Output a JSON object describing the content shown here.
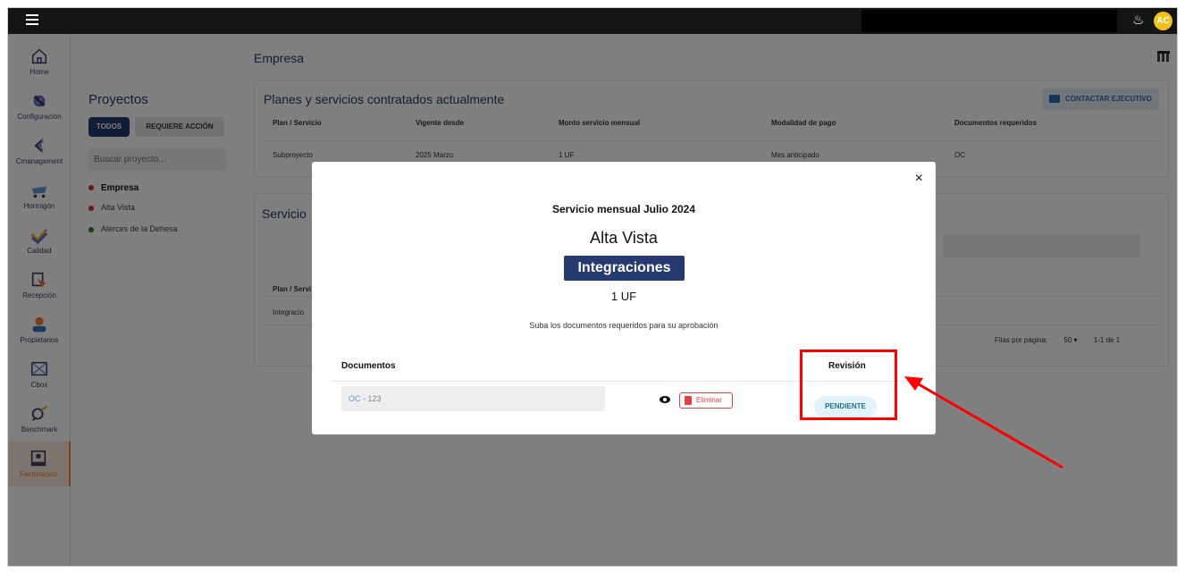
{
  "topbar": {
    "avatar_initials": "AC"
  },
  "sidebar": {
    "items": [
      {
        "label": "Home",
        "icon": "home-icon"
      },
      {
        "label": "Configuración",
        "icon": "settings-icon"
      },
      {
        "label": "Cmanagement",
        "icon": "cmanagement-icon"
      },
      {
        "label": "Hormigón",
        "icon": "concrete-mixer-icon"
      },
      {
        "label": "Calidad",
        "icon": "quality-check-icon"
      },
      {
        "label": "Recepción",
        "icon": "reception-icon"
      },
      {
        "label": "Propietarios",
        "icon": "owners-icon"
      },
      {
        "label": "Cbox",
        "icon": "cbox-icon"
      },
      {
        "label": "Benchmark",
        "icon": "benchmark-icon"
      },
      {
        "label": "Facturación",
        "icon": "billing-icon"
      }
    ],
    "active": "Facturación"
  },
  "projects": {
    "title": "Proyectos",
    "tab_all": "TODOS",
    "tab_action": "REQUIERE ACCIÓN",
    "search_placeholder": "Buscar proyecto...",
    "items": [
      {
        "name": "Empresa",
        "color": "#d32f2f"
      },
      {
        "name": "Alta Vista",
        "color": "#d32f2f"
      },
      {
        "name": "Alerces de la Dehesa",
        "color": "#2e7d32"
      }
    ]
  },
  "main": {
    "section_title": "Empresa",
    "plans_title": "Planes y servicios contratados actualmente",
    "contact_label": "CONTACTAR EJECUTIVO",
    "plans_headers": [
      "Plan / Servicio",
      "Vigente desde",
      "Monto servicio mensual",
      "Modalidad de pago",
      "Documentos requeridos"
    ],
    "plans_row": [
      "Subproyecto",
      "2025 Marzo",
      "1 UF",
      "Mes anticipado",
      "OC"
    ],
    "services_title": "Servicio",
    "services_header_partial": "Plan / Servi",
    "services_row_partial": "Integracio",
    "rows_per_page_label": "Filas por página:",
    "rows_per_page_value": "50",
    "range": "1-1 de 1"
  },
  "modal": {
    "title": "Servicio mensual Julio 2024",
    "project": "Alta Vista",
    "badge": "Integraciones",
    "amount": "1 UF",
    "subtitle": "Suba los documentos requeridos para su aprobación",
    "documents_header": "Documentos",
    "review_header": "Revisión",
    "doc_type": "OC",
    "doc_sep": " - ",
    "doc_number": "123",
    "delete_label": "Eliminar",
    "status": "PENDIENTE",
    "close": "×"
  }
}
